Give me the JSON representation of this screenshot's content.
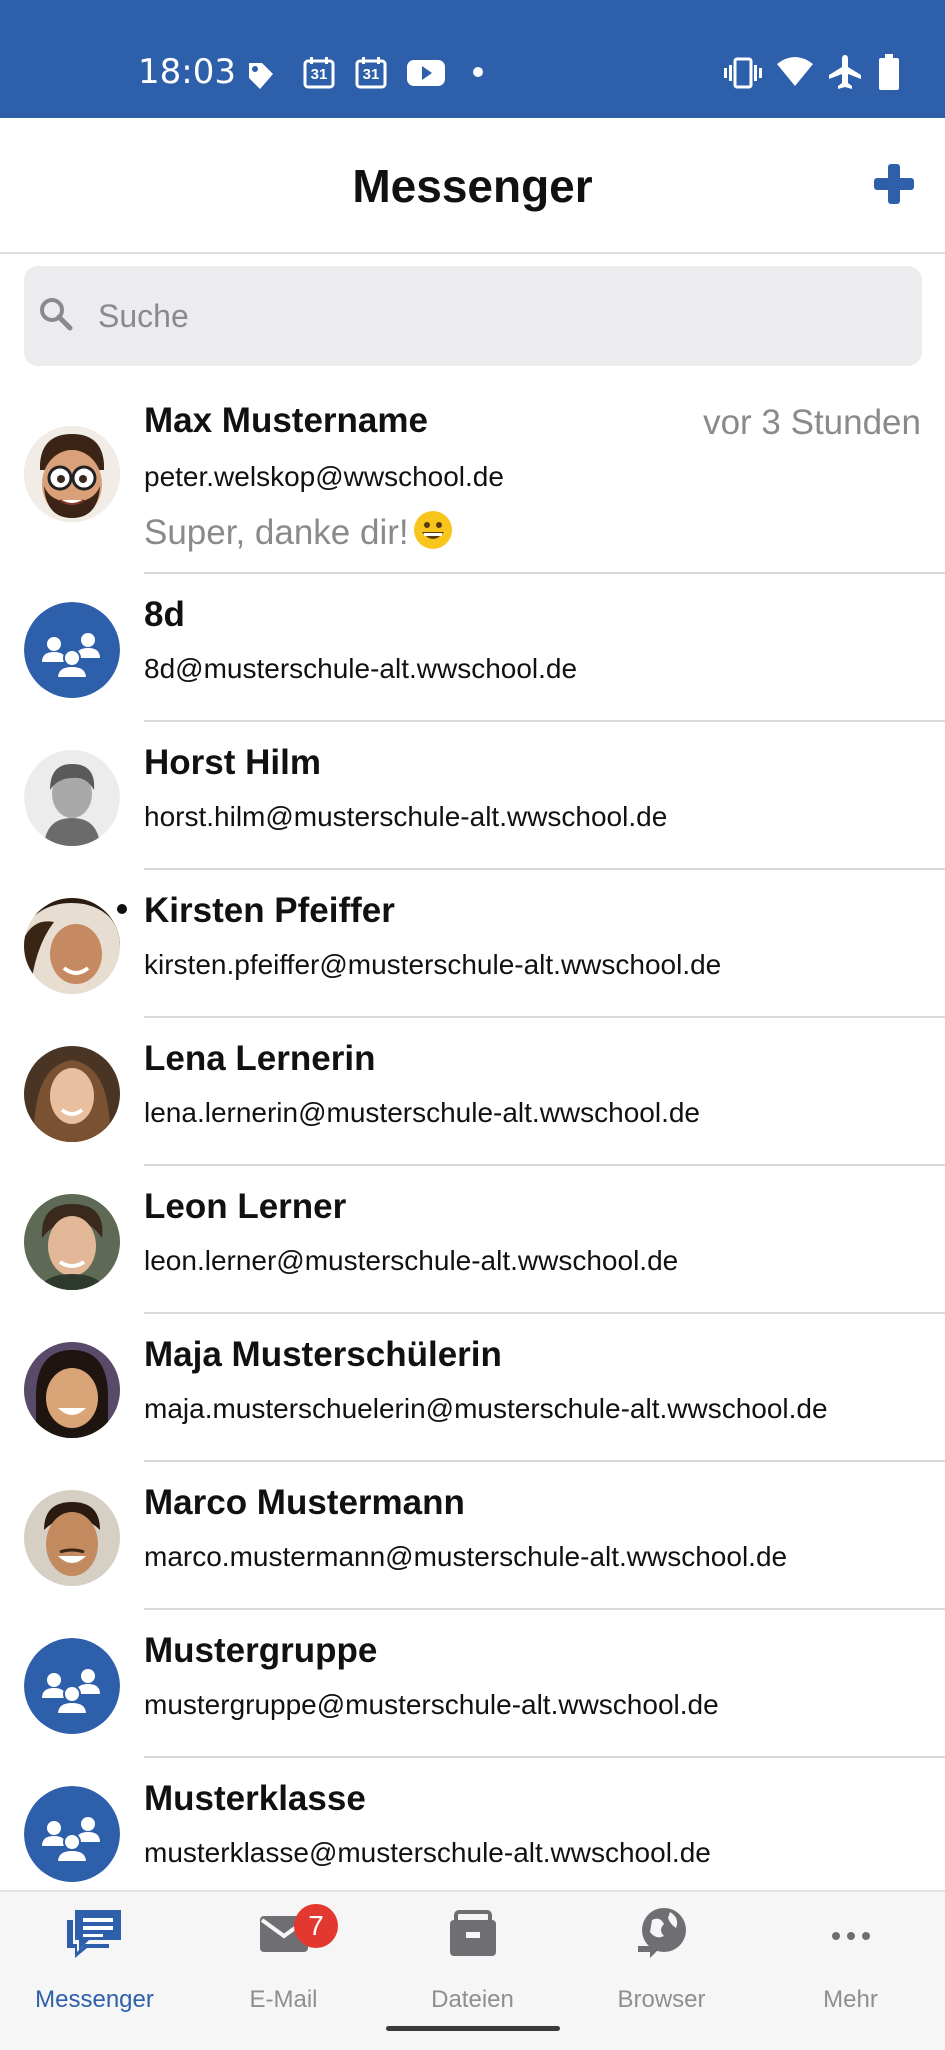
{
  "status_bar": {
    "time": "18:03",
    "calendar_day_1": "31",
    "calendar_day_2": "31",
    "left_icons": [
      "tag-icon",
      "calendar-icon",
      "calendar-icon",
      "youtube-icon",
      "dot-icon"
    ],
    "right_icons": [
      "vibrate-icon",
      "wifi-icon",
      "airplane-icon",
      "battery-icon"
    ]
  },
  "header": {
    "title": "Messenger",
    "add_icon": "plus-icon"
  },
  "search": {
    "placeholder": "Suche"
  },
  "contacts": [
    {
      "name": "Max Mustername",
      "email": "peter.welskop@wwschool.de",
      "time": "vor 3 Stunden",
      "preview": "Super, danke dir!",
      "avatar": "memoji"
    },
    {
      "name": "8d",
      "email": "8d@musterschule-alt.wwschool.de",
      "avatar": "group"
    },
    {
      "name": "Horst Hilm",
      "email": "horst.hilm@musterschule-alt.wwschool.de",
      "avatar": "placeholder"
    },
    {
      "name": "Kirsten Pfeiffer",
      "email": "kirsten.pfeiffer@musterschule-alt.wwschool.de",
      "avatar": "photo",
      "unread": true
    },
    {
      "name": "Lena Lernerin",
      "email": "lena.lernerin@musterschule-alt.wwschool.de",
      "avatar": "photo"
    },
    {
      "name": "Leon Lerner",
      "email": "leon.lerner@musterschule-alt.wwschool.de",
      "avatar": "photo"
    },
    {
      "name": "Maja Musterschülerin",
      "email": "maja.musterschuelerin@musterschule-alt.wwschool.de",
      "avatar": "photo"
    },
    {
      "name": "Marco Mustermann",
      "email": "marco.mustermann@musterschule-alt.wwschool.de",
      "avatar": "photo"
    },
    {
      "name": "Mustergruppe",
      "email": "mustergruppe@musterschule-alt.wwschool.de",
      "avatar": "group"
    },
    {
      "name": "Musterklasse",
      "email": "musterklasse@musterschule-alt.wwschool.de",
      "avatar": "group"
    }
  ],
  "bottom_nav": [
    {
      "label": "Messenger",
      "icon": "chat-icon",
      "active": true
    },
    {
      "label": "E-Mail",
      "icon": "mail-icon",
      "badge": "7"
    },
    {
      "label": "Dateien",
      "icon": "briefcase-icon"
    },
    {
      "label": "Browser",
      "icon": "globe-icon"
    },
    {
      "label": "Mehr",
      "icon": "more-icon"
    }
  ],
  "colors": {
    "brand": "#2e5fab",
    "badge": "#e2382f",
    "muted": "#8a8a8a"
  }
}
